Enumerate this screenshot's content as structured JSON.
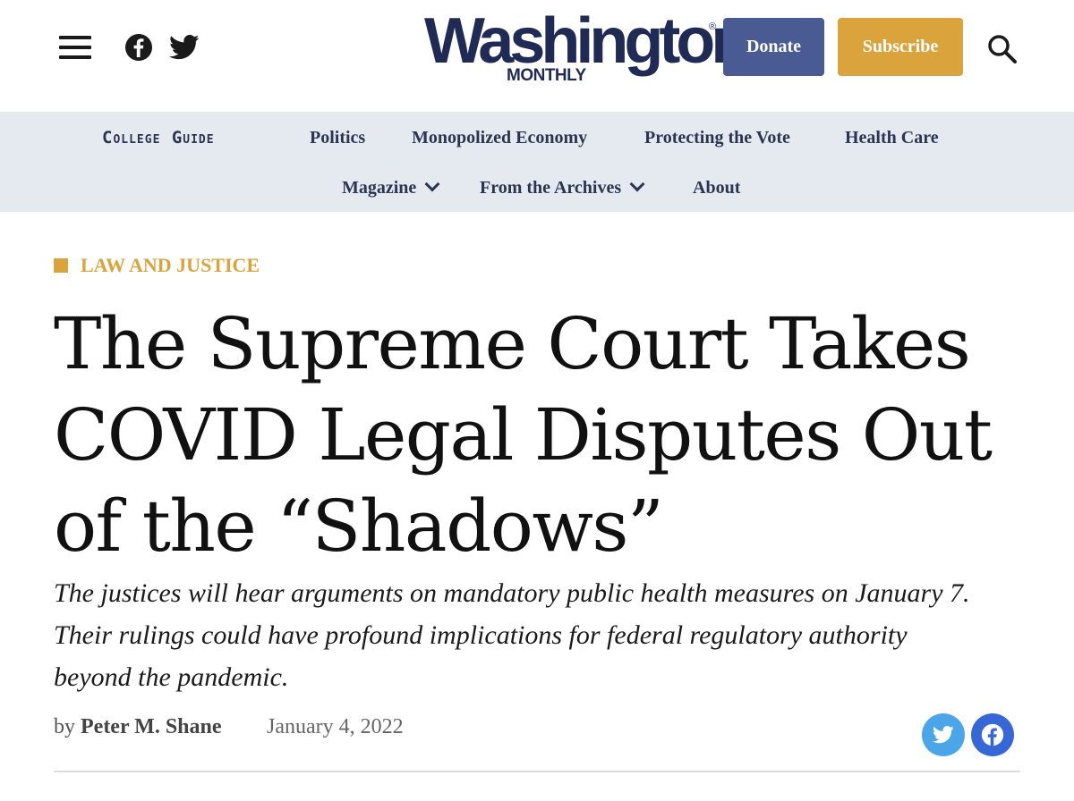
{
  "header": {
    "menu_icon": "hamburger-menu-icon",
    "social": [
      "facebook-icon",
      "twitter-icon"
    ],
    "logo": {
      "main": "Washington",
      "registered": "®",
      "sub": "MONTHLY"
    },
    "donate_label": "Donate",
    "subscribe_label": "Subscribe",
    "search_icon": "search-icon",
    "colors": {
      "brand_navy": "#1f2a55",
      "donate_bg": "#4a5b94",
      "subscribe_bg": "#dba33b"
    }
  },
  "nav": {
    "row1": [
      "College Guide",
      "Politics",
      "Monopolized Economy",
      "Protecting the Vote",
      "Health Care"
    ],
    "row2": [
      {
        "label": "Magazine",
        "has_dropdown": true
      },
      {
        "label": "From the Archives",
        "has_dropdown": true
      },
      {
        "label": "About",
        "has_dropdown": false
      }
    ],
    "background": "#e5eaf0"
  },
  "article": {
    "category": "LAW AND JUSTICE",
    "headline_lines": [
      "The Supreme Court Takes",
      "COVID Legal Disputes Out",
      "of the “Shadows”"
    ],
    "dek_lines": [
      "The justices will hear arguments on mandatory public health measures on January 7.",
      "Their rulings could have profound implications for federal regulatory authority",
      "beyond the pandemic."
    ],
    "byline_prefix": "by",
    "author": "Peter M. Shane",
    "date": "January 4, 2022",
    "share": [
      "twitter-share-icon",
      "facebook-share-icon"
    ],
    "accent_color": "#dba33b"
  }
}
